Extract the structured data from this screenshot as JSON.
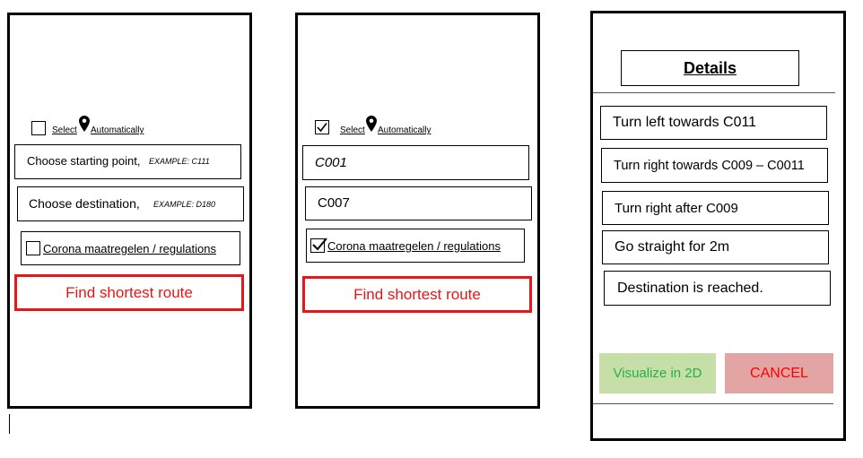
{
  "screen1": {
    "auto_select": {
      "select": "Select",
      "automatically": "Automatically",
      "checked": false
    },
    "start": {
      "label": "Choose starting point,",
      "example": "EXAMPLE: C111"
    },
    "destination": {
      "label": "Choose destination,",
      "example": "EXAMPLE: D180"
    },
    "corona": {
      "label": "Corona maatregelen / regulations",
      "checked": false
    },
    "find_button": "Find shortest route"
  },
  "screen2": {
    "auto_select": {
      "select": "Select",
      "automatically": "Automatically",
      "checked": true
    },
    "start_value": "C001",
    "destination_value": "C007",
    "corona": {
      "label": "Corona maatregelen / regulations",
      "checked": true
    },
    "find_button": "Find shortest route"
  },
  "screen3": {
    "title": "Details",
    "steps": [
      "Turn left towards C011",
      "Turn right towards C009 – C0011",
      "Turn right after C009",
      "Go straight for 2m",
      "Destination is reached."
    ],
    "visualize_button": "Visualize in 2D",
    "cancel_button": "CANCEL"
  },
  "colors": {
    "accent_red": "#e81616",
    "visualize_bg": "#c6dfa9",
    "visualize_text": "#23b14d",
    "cancel_bg": "#e3a5a4",
    "cancel_text": "#ff0000"
  }
}
